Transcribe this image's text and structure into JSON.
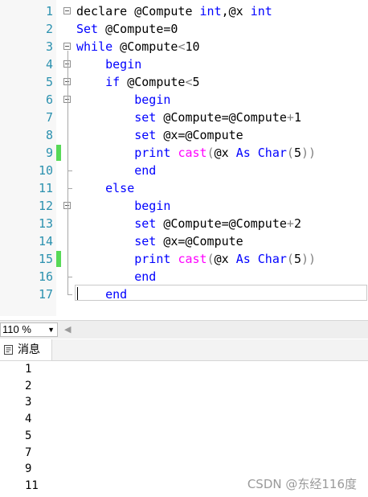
{
  "editor": {
    "line_numbers": [
      "1",
      "2",
      "3",
      "4",
      "5",
      "6",
      "7",
      "8",
      "9",
      "10",
      "11",
      "12",
      "13",
      "14",
      "15",
      "16",
      "17"
    ],
    "lines": [
      [
        {
          "t": "declare @Compute ",
          "c": ""
        },
        {
          "t": "int",
          "c": "kw"
        },
        {
          "t": ",@x ",
          "c": ""
        },
        {
          "t": "int",
          "c": "kw"
        }
      ],
      [
        {
          "t": "Set",
          "c": "kw"
        },
        {
          "t": " @Compute=0",
          "c": ""
        }
      ],
      [
        {
          "t": "while",
          "c": "kw"
        },
        {
          "t": " @Compute",
          "c": ""
        },
        {
          "t": "<",
          "c": "op"
        },
        {
          "t": "10",
          "c": ""
        }
      ],
      [
        {
          "t": "    begin",
          "c": "kw"
        }
      ],
      [
        {
          "t": "    if",
          "c": "kw"
        },
        {
          "t": " @Compute",
          "c": ""
        },
        {
          "t": "<",
          "c": "op"
        },
        {
          "t": "5",
          "c": ""
        }
      ],
      [
        {
          "t": "        begin",
          "c": "kw"
        }
      ],
      [
        {
          "t": "        set",
          "c": "kw"
        },
        {
          "t": " @Compute=@Compute",
          "c": ""
        },
        {
          "t": "+",
          "c": "op"
        },
        {
          "t": "1",
          "c": ""
        }
      ],
      [
        {
          "t": "        set",
          "c": "kw"
        },
        {
          "t": " @x=@Compute",
          "c": ""
        }
      ],
      [
        {
          "t": "        print",
          "c": "kw"
        },
        {
          "t": " ",
          "c": ""
        },
        {
          "t": "cast",
          "c": "fn"
        },
        {
          "t": "(",
          "c": "op"
        },
        {
          "t": "@x ",
          "c": ""
        },
        {
          "t": "As",
          "c": "kw"
        },
        {
          "t": " ",
          "c": ""
        },
        {
          "t": "Char",
          "c": "kw"
        },
        {
          "t": "(",
          "c": "op"
        },
        {
          "t": "5",
          "c": ""
        },
        {
          "t": "))",
          "c": "op"
        }
      ],
      [
        {
          "t": "        end",
          "c": "kw"
        }
      ],
      [
        {
          "t": "    else",
          "c": "kw"
        }
      ],
      [
        {
          "t": "        begin",
          "c": "kw"
        }
      ],
      [
        {
          "t": "        set",
          "c": "kw"
        },
        {
          "t": " @Compute=@Compute",
          "c": ""
        },
        {
          "t": "+",
          "c": "op"
        },
        {
          "t": "2",
          "c": ""
        }
      ],
      [
        {
          "t": "        set",
          "c": "kw"
        },
        {
          "t": " @x=@Compute",
          "c": ""
        }
      ],
      [
        {
          "t": "        print",
          "c": "kw"
        },
        {
          "t": " ",
          "c": ""
        },
        {
          "t": "cast",
          "c": "fn"
        },
        {
          "t": "(",
          "c": "op"
        },
        {
          "t": "@x ",
          "c": ""
        },
        {
          "t": "As",
          "c": "kw"
        },
        {
          "t": " ",
          "c": ""
        },
        {
          "t": "Char",
          "c": "kw"
        },
        {
          "t": "(",
          "c": "op"
        },
        {
          "t": "5",
          "c": ""
        },
        {
          "t": "))",
          "c": "op"
        }
      ],
      [
        {
          "t": "        end",
          "c": "kw"
        }
      ],
      [
        {
          "t": "    end",
          "c": "kw"
        }
      ]
    ],
    "changed_lines": [
      9,
      15
    ],
    "colors": {
      "keyword": "#0000ff",
      "function": "#ff00ff",
      "operator": "#808080",
      "line_number": "#2b91af",
      "change_marker": "#57d957"
    }
  },
  "statusbar": {
    "zoom": "110 %"
  },
  "results": {
    "tab_label": "消息",
    "tab_icon": "messages-icon",
    "messages": [
      "1",
      "2",
      "3",
      "4",
      "5",
      "7",
      "9",
      "11"
    ]
  },
  "watermark": "CSDN @东经116度"
}
